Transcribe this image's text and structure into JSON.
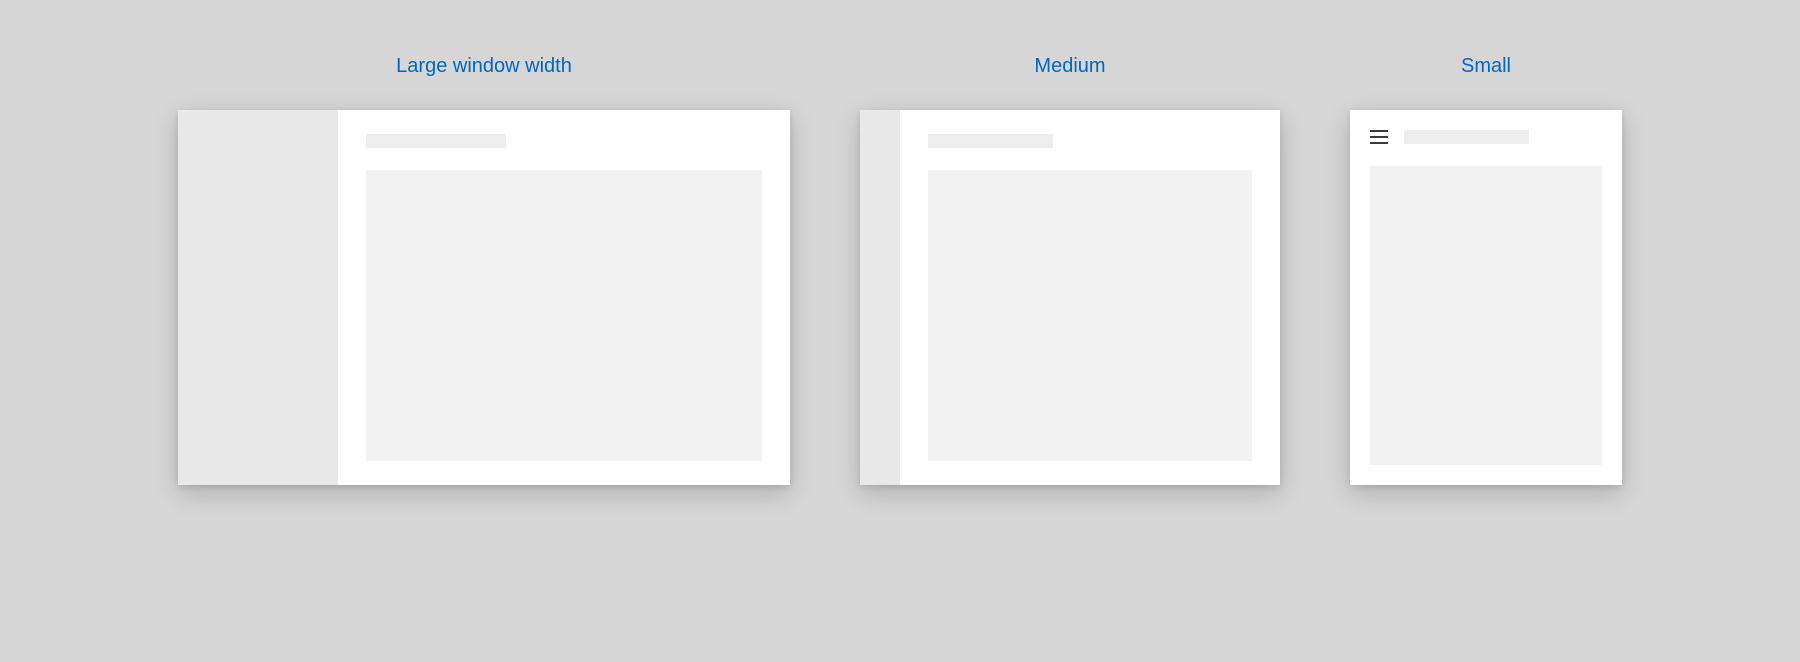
{
  "variants": {
    "large": {
      "label": "Large window width"
    },
    "medium": {
      "label": "Medium"
    },
    "small": {
      "label": "Small"
    }
  }
}
